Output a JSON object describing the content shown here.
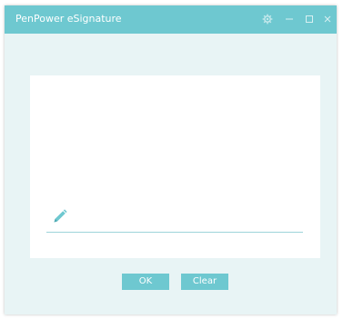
{
  "window": {
    "title": "PenPower eSignature"
  },
  "titlebar": {
    "icons": [
      "gear-icon",
      "minimize-icon",
      "maximize-icon",
      "close-icon"
    ],
    "color": "#6ec8d0"
  },
  "signature_pad": {
    "icon": "pencil-icon",
    "background": "#ffffff",
    "line_color": "#9dd4da"
  },
  "buttons": {
    "ok_label": "OK",
    "clear_label": "Clear"
  },
  "colors": {
    "accent": "#6ec8d0",
    "window_bg": "#e8f4f5"
  }
}
